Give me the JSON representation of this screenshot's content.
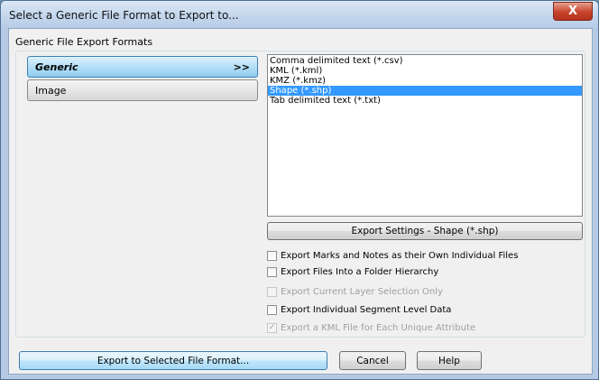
{
  "window": {
    "title": "Select a Generic File Format to Export to...",
    "close_label": "X"
  },
  "group": {
    "label": "Generic File Export Formats"
  },
  "categories": [
    {
      "label": "Generic",
      "arrow": ">>",
      "selected": true
    },
    {
      "label": "Image",
      "selected": false
    }
  ],
  "formats": [
    {
      "label": "Comma delimited text (*.csv)",
      "selected": false
    },
    {
      "label": "KML (*.kml)",
      "selected": false
    },
    {
      "label": "KMZ (*.kmz)",
      "selected": false
    },
    {
      "label": "Shape (*.shp)",
      "selected": true
    },
    {
      "label": "Tab delimited text (*.txt)",
      "selected": false
    }
  ],
  "settings_button": "Export Settings - Shape (*.shp)",
  "options": [
    {
      "label": "Export Marks and Notes as their Own Individual Files",
      "checked": false,
      "enabled": true
    },
    {
      "label": "Export Files Into a Folder Hierarchy",
      "checked": false,
      "enabled": true
    },
    {
      "label": "Export Current Layer Selection Only",
      "checked": false,
      "enabled": false
    },
    {
      "label": "Export Individual Segment Level Data",
      "checked": false,
      "enabled": true
    },
    {
      "label": "Export a KML File for Each Unique Attribute",
      "checked": true,
      "enabled": false
    }
  ],
  "buttons": {
    "export": "Export to Selected File Format...",
    "cancel": "Cancel",
    "help": "Help"
  },
  "colors": {
    "selection": "#3399ff",
    "category_selected": "#8fcdf0",
    "close_button": "#c7432b"
  }
}
